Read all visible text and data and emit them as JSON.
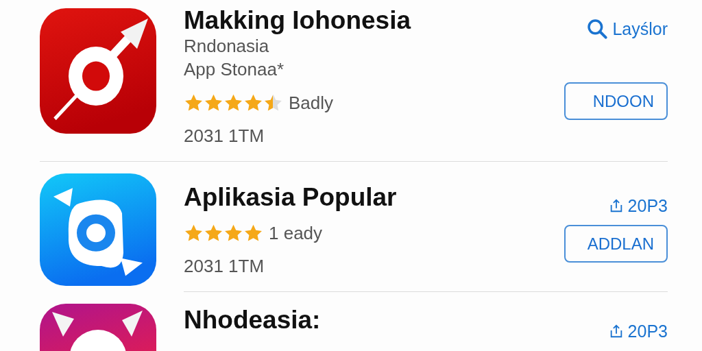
{
  "apps": [
    {
      "title": "Makking Iohonesia",
      "subtitles": [
        "Rndonasia",
        "App Stonaa*"
      ],
      "stars": 4.5,
      "rating_text": "Badly",
      "meta": "2031 1TM",
      "link": {
        "label": "Layślor"
      },
      "button": "NDOON"
    },
    {
      "title": "Aplikasia Popular",
      "stars": 4,
      "rating_text": "1 eady",
      "meta": "2031 1TM",
      "link": {
        "label": "20P3"
      },
      "button": "ADDLAN"
    },
    {
      "title": "Nhodeasia:",
      "link": {
        "label": "20P3"
      }
    }
  ]
}
